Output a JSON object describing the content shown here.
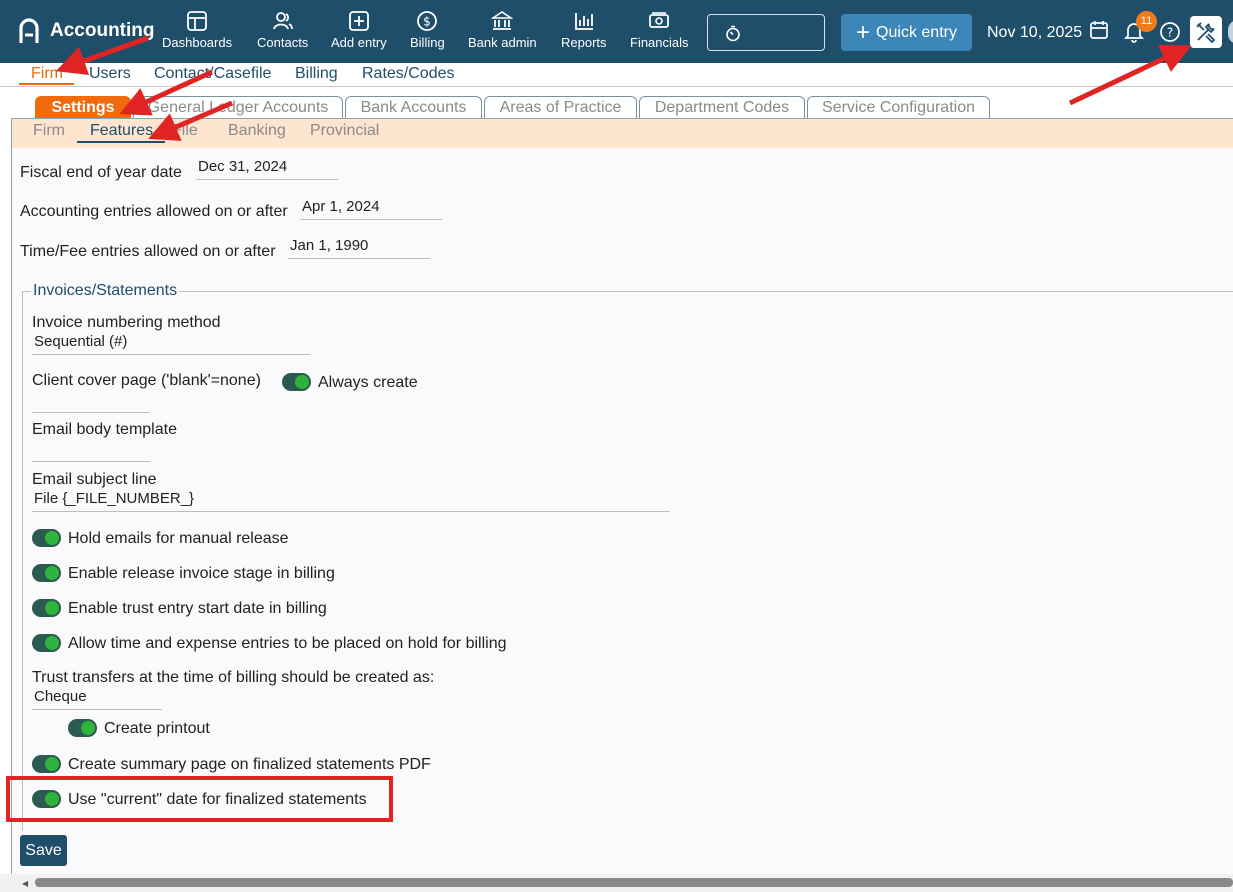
{
  "app": {
    "name": "Accounting",
    "date": "Nov 10, 2025",
    "notifications_count": "11",
    "quick_entry_label": "Quick entry"
  },
  "nav": [
    {
      "label": "Dashboards",
      "icon": "dashboard-icon"
    },
    {
      "label": "Contacts",
      "icon": "contacts-icon"
    },
    {
      "label": "Add entry",
      "icon": "add-entry-icon"
    },
    {
      "label": "Billing",
      "icon": "billing-icon"
    },
    {
      "label": "Bank admin",
      "icon": "bank-icon"
    },
    {
      "label": "Reports",
      "icon": "reports-icon"
    },
    {
      "label": "Financials",
      "icon": "financials-icon"
    }
  ],
  "menu": [
    "Firm",
    "Users",
    "Contact/Casefile",
    "Billing",
    "Rates/Codes"
  ],
  "tabs": [
    "Settings",
    "General Ledger Accounts",
    "Bank Accounts",
    "Areas of Practice",
    "Department Codes",
    "Service Configuration"
  ],
  "subtabs": [
    "Firm",
    "Features",
    "File",
    "Banking",
    "Provincial"
  ],
  "fields": {
    "fiscal_label": "Fiscal end of year date",
    "fiscal_value": "Dec 31, 2024",
    "accounting_label": "Accounting entries allowed on or after",
    "accounting_value": "Apr 1, 2024",
    "timefee_label": "Time/Fee entries allowed on or after",
    "timefee_value": "Jan 1, 1990"
  },
  "invoices": {
    "legend": "Invoices/Statements",
    "numbering_label": "Invoice numbering method",
    "numbering_value": "Sequential (#)",
    "cover_label": "Client cover page ('blank'=none)",
    "cover_toggle_label": "Always create",
    "cover_value": "",
    "email_body_label": "Email body template",
    "email_body_value": "",
    "email_subject_label": "Email subject line",
    "email_subject_value": "File {_FILE_NUMBER_}",
    "toggles": [
      "Hold emails for manual release",
      "Enable release invoice stage in billing",
      "Enable trust entry start date in billing",
      "Allow time and expense entries to be placed on hold for billing"
    ],
    "trust_label": "Trust transfers at the time of billing should be created as:",
    "trust_value": "Cheque",
    "printout_label": "Create printout",
    "summary_label": "Create summary page on finalized statements PDF",
    "current_date_label": "Use \"current\" date for finalized statements"
  },
  "save_label": "Save",
  "colors": {
    "header": "#1f4e6b",
    "accent": "#e86a0c",
    "toggle_on": "#2fb33a",
    "annotation": "#e02424"
  }
}
